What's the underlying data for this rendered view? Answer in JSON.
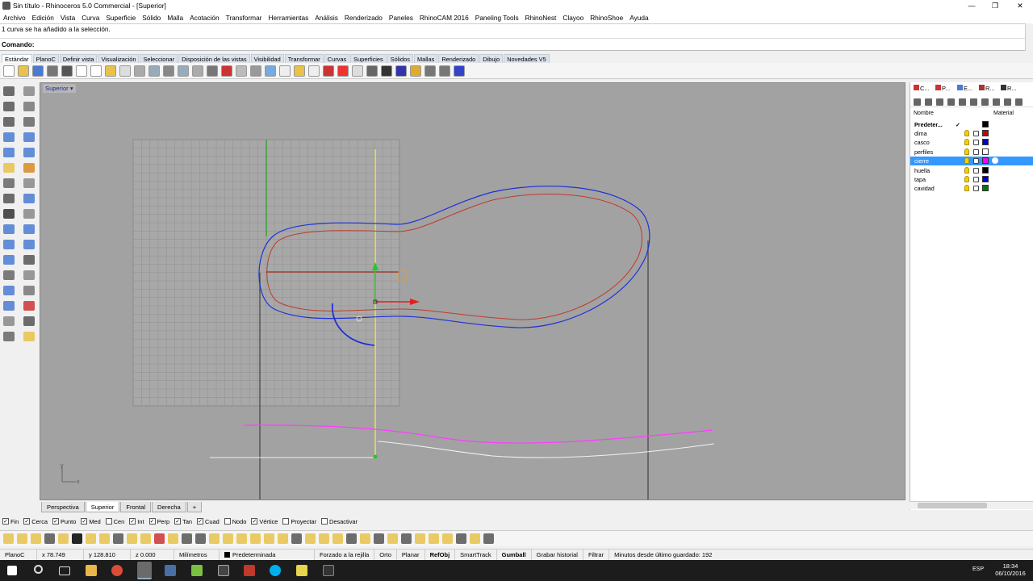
{
  "window": {
    "title": "Sin título - Rhinoceros 5.0 Commercial - [Superior]"
  },
  "menu": [
    "Archivo",
    "Edición",
    "Vista",
    "Curva",
    "Superficie",
    "Sólido",
    "Malla",
    "Acotación",
    "Transformar",
    "Herramientas",
    "Análisis",
    "Renderizado",
    "Paneles",
    "RhinoCAM 2016",
    "Paneling Tools",
    "RhinoNest",
    "Clayoo",
    "RhinoShoe",
    "Ayuda"
  ],
  "history": {
    "text": "1 curva se ha añadido a la selección."
  },
  "command": {
    "label": "Comando:"
  },
  "toolbar_tabs": [
    "Estándar",
    "PlanoC",
    "Definir vista",
    "Visualización",
    "Seleccionar",
    "Disposición de las vistas",
    "Visibilidad",
    "Transformar",
    "Curvas",
    "Superficies",
    "Sólidos",
    "Mallas",
    "Renderizado",
    "Dibujo",
    "Novedades V5"
  ],
  "viewport": {
    "title": "Superior",
    "axis_x": "x",
    "axis_y": "y"
  },
  "viewport_tabs": [
    "Perspectiva",
    "Superior",
    "Frontal",
    "Derecha"
  ],
  "viewport_tab_add": "+",
  "osnaps": [
    {
      "label": "Fin",
      "checked": true
    },
    {
      "label": "Cerca",
      "checked": true
    },
    {
      "label": "Punto",
      "checked": true
    },
    {
      "label": "Med",
      "checked": true
    },
    {
      "label": "Cen",
      "checked": false
    },
    {
      "label": "Int",
      "checked": true
    },
    {
      "label": "Perp",
      "checked": true
    },
    {
      "label": "Tan",
      "checked": true
    },
    {
      "label": "Cuad",
      "checked": true
    },
    {
      "label": "Nodo",
      "checked": false
    },
    {
      "label": "Vértice",
      "checked": true
    },
    {
      "label": "Proyectar",
      "checked": false
    },
    {
      "label": "Desactivar",
      "checked": false
    }
  ],
  "status": {
    "cplane": "PlanoC",
    "x": "x 78.749",
    "y": "y 128.810",
    "z": "z 0.000",
    "units": "Milímetros",
    "layer": "Predeterminada",
    "grid_snap": "Forzado a la rejilla",
    "ortho": "Orto",
    "planar": "Planar",
    "osnap": "RefObj",
    "smarttrack": "SmartTrack",
    "gumball": "Gumball",
    "record_history": "Grabar historial",
    "filter": "Filtrar",
    "saved": "Minutos desde último guardado: 192"
  },
  "panel": {
    "tabs": [
      "C...",
      "P...",
      "E...",
      "R...",
      "R..."
    ],
    "col_name": "Nombre",
    "col_material": "Material",
    "default_layer": "Predeter...",
    "default_check": "✓",
    "layers": [
      {
        "name": "dima",
        "color": "#cc0000",
        "selected": false
      },
      {
        "name": "casco",
        "color": "#0000cc",
        "selected": false
      },
      {
        "name": "perfiles",
        "color": "#ffffff",
        "selected": false
      },
      {
        "name": "cierre",
        "color": "#ff00ff",
        "selected": true
      },
      {
        "name": "huella",
        "color": "#000000",
        "selected": false
      },
      {
        "name": "tapa",
        "color": "#0000cc",
        "selected": false
      },
      {
        "name": "cavidad",
        "color": "#007a00",
        "selected": false
      }
    ]
  },
  "taskbar": {
    "time": "18:34",
    "date": "06/10/2016",
    "lang": "ESP"
  }
}
